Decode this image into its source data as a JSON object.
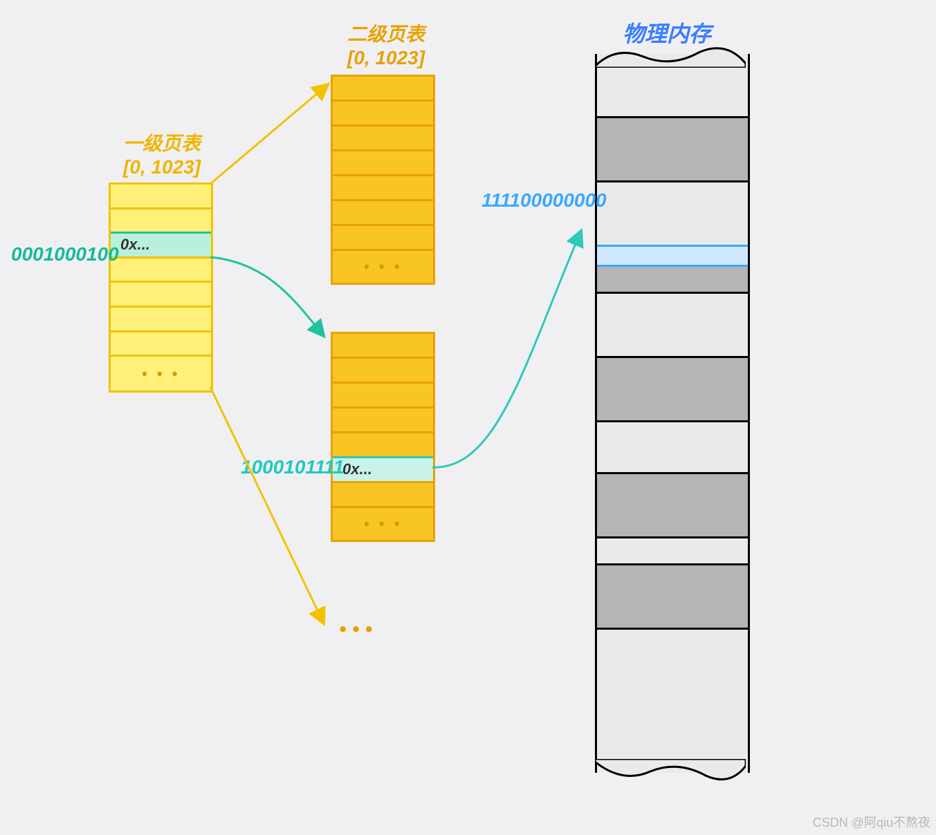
{
  "l1": {
    "title": "一级页表",
    "range": "[0, 1023]",
    "index": "0001000100",
    "value": "0x...",
    "ellipsis": "• • •"
  },
  "l2": {
    "title": "二级页表",
    "range": "[0, 1023]",
    "index": "1000101111",
    "value": "0x...",
    "ellipsis_top": "• • •",
    "ellipsis_bot": "• • •"
  },
  "phys": {
    "title": "物理内存",
    "addr": "111100000000"
  },
  "more": "• • •",
  "watermark": "CSDN @阿qiu不熬夜"
}
